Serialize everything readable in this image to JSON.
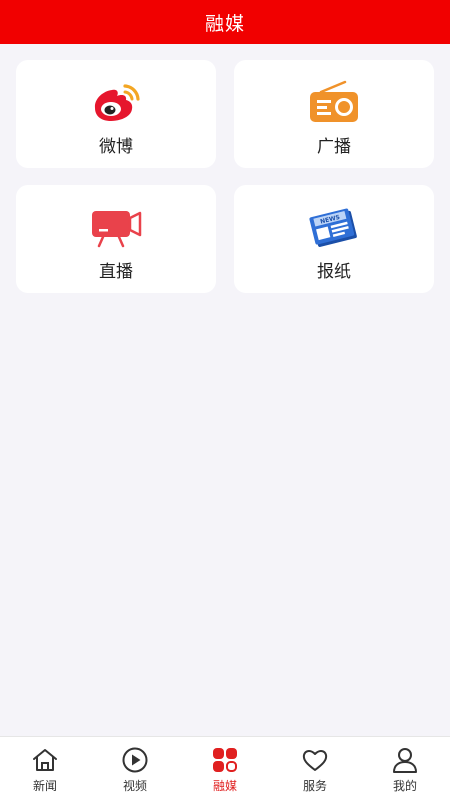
{
  "header": {
    "title": "融媒"
  },
  "grid": {
    "items": [
      {
        "label": "微博",
        "icon": "weibo-icon"
      },
      {
        "label": "广播",
        "icon": "radio-icon"
      },
      {
        "label": "直播",
        "icon": "live-tv-icon"
      },
      {
        "label": "报纸",
        "icon": "newspaper-icon"
      }
    ]
  },
  "tabbar": {
    "tabs": [
      {
        "label": "新闻",
        "icon": "home-icon"
      },
      {
        "label": "视频",
        "icon": "play-icon"
      },
      {
        "label": "融媒",
        "icon": "grid-icon",
        "active": true
      },
      {
        "label": "服务",
        "icon": "heart-icon"
      },
      {
        "label": "我的",
        "icon": "user-icon"
      }
    ]
  },
  "newspaper_badge": "NEWS",
  "colors": {
    "header_bg": "#f10000",
    "page_bg": "#f5f4f9",
    "active_tab": "#e02020",
    "radio_orange": "#f0922a",
    "live_red": "#e9424b",
    "newspaper_blue": "#2f6fd6"
  }
}
